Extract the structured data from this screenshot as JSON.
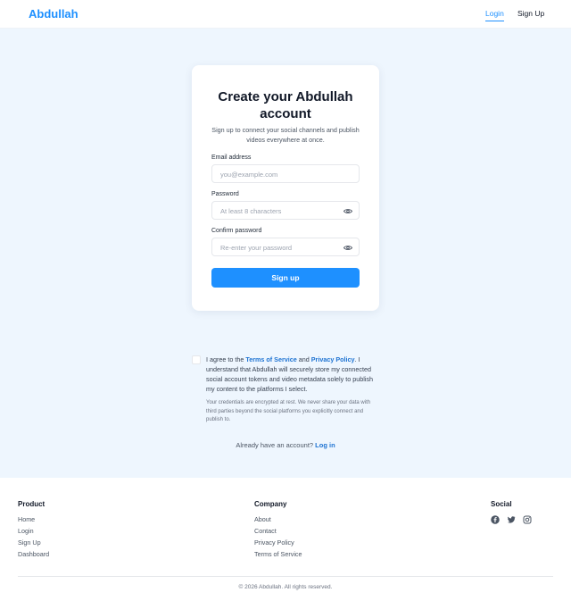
{
  "header": {
    "brand": "Abdullah",
    "nav_login": "Login",
    "nav_signup": "Sign Up"
  },
  "card": {
    "title": "Create your Abdullah account",
    "subtitle": "Sign up to connect your social channels and publish videos everywhere at once.",
    "email_label": "Email address",
    "email_placeholder": "you@example.com",
    "password_label": "Password",
    "password_placeholder": "At least 8 characters",
    "confirm_label": "Confirm password",
    "confirm_placeholder": "Re-enter your password",
    "submit_label": "Sign up"
  },
  "agreement": {
    "prefix": "I agree to the ",
    "terms_link": "Terms of Service",
    "and": " and ",
    "privacy_link": "Privacy Policy",
    "suffix": ". I understand that Abdullah will securely store my connected social account tokens and video metadata solely to publish my content to the platforms I select.",
    "note": "Your credentials are encrypted at rest. We never share your data with third parties beyond the social platforms you explicitly connect and publish to.",
    "checked": false
  },
  "login_prompt": {
    "text": "Already have an account? ",
    "link": "Log in"
  },
  "footer": {
    "product_heading": "Product",
    "product_links": [
      "Home",
      "Login",
      "Sign Up",
      "Dashboard"
    ],
    "company_heading": "Company",
    "company_links": [
      "About",
      "Contact",
      "Privacy Policy",
      "Terms of Service"
    ],
    "social_heading": "Social",
    "social_icons": [
      "facebook-icon",
      "twitter-icon",
      "instagram-icon"
    ],
    "copyright": "© 2026 Abdullah. All rights reserved."
  },
  "colors": {
    "accent": "#1e90ff",
    "band_background": "#eef6fe",
    "link": "#1e73d2"
  }
}
